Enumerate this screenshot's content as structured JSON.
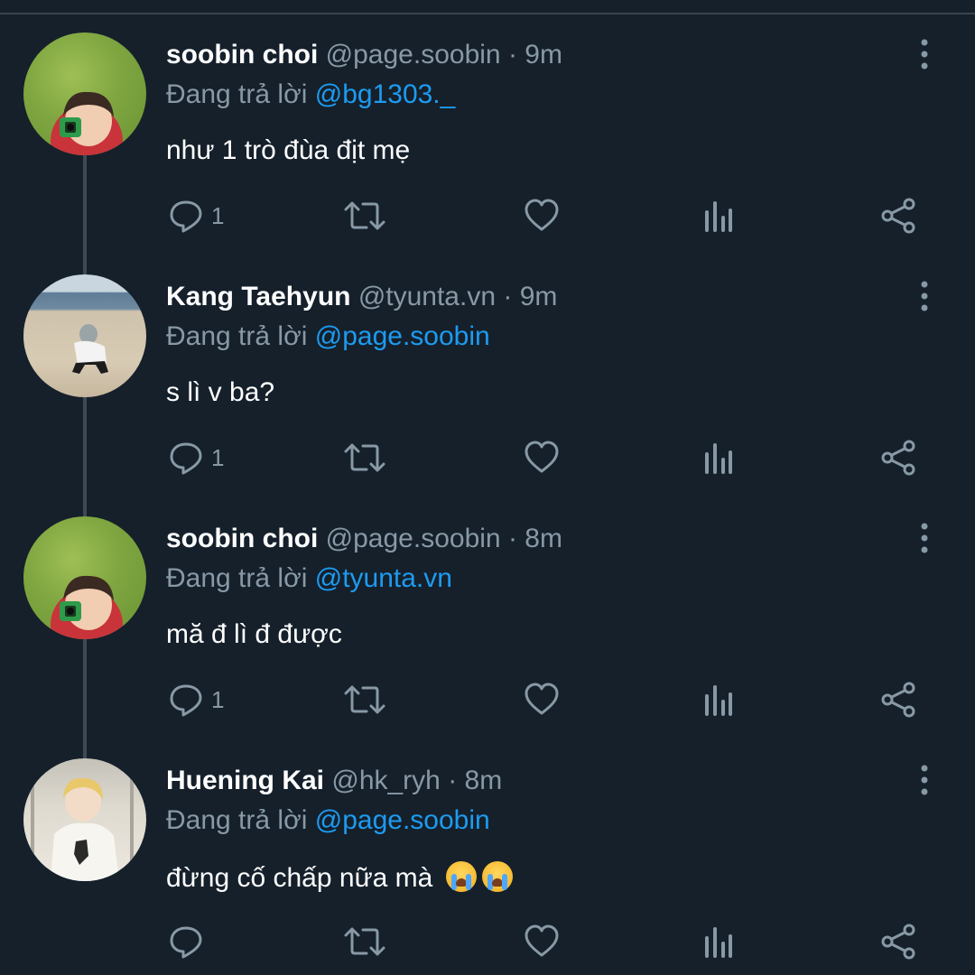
{
  "colors": {
    "background": "#15202b",
    "primary_text": "#ffffff",
    "secondary_text": "#8899a6",
    "mention": "#1d9bf0",
    "divider": "#38444d"
  },
  "tweets": [
    {
      "name": "soobin choi",
      "handle": "@page.soobin",
      "separator": "·",
      "time": "9m",
      "reply_prefix": "Đang trả lời",
      "reply_to": "@bg1303._",
      "text": "như 1 trò đùa địt mẹ",
      "reply_count": "1",
      "avatar_icon": "avatar-grass-photo"
    },
    {
      "name": "Kang Taehyun",
      "handle": "@tyunta.vn",
      "separator": "·",
      "time": "9m",
      "reply_prefix": "Đang trả lời",
      "reply_to": "@page.soobin",
      "text": "s lì v ba?",
      "reply_count": "1",
      "avatar_icon": "avatar-beach-photo"
    },
    {
      "name": "soobin choi",
      "handle": "@page.soobin",
      "separator": "·",
      "time": "8m",
      "reply_prefix": "Đang trả lời",
      "reply_to": "@tyunta.vn",
      "text": "mă đ lì đ được",
      "reply_count": "1",
      "avatar_icon": "avatar-grass-photo"
    },
    {
      "name": "Huening Kai",
      "handle": "@hk_ryh",
      "separator": "·",
      "time": "8m",
      "reply_prefix": "Đang trả lời",
      "reply_to": "@page.soobin",
      "text": "đừng cố chấp nữa mà",
      "text_emoji": "loudly-crying-face x2",
      "reply_count": "",
      "avatar_icon": "avatar-person-photo"
    }
  ],
  "action_icons": [
    "reply-icon",
    "retweet-icon",
    "like-icon",
    "views-icon",
    "share-icon"
  ]
}
